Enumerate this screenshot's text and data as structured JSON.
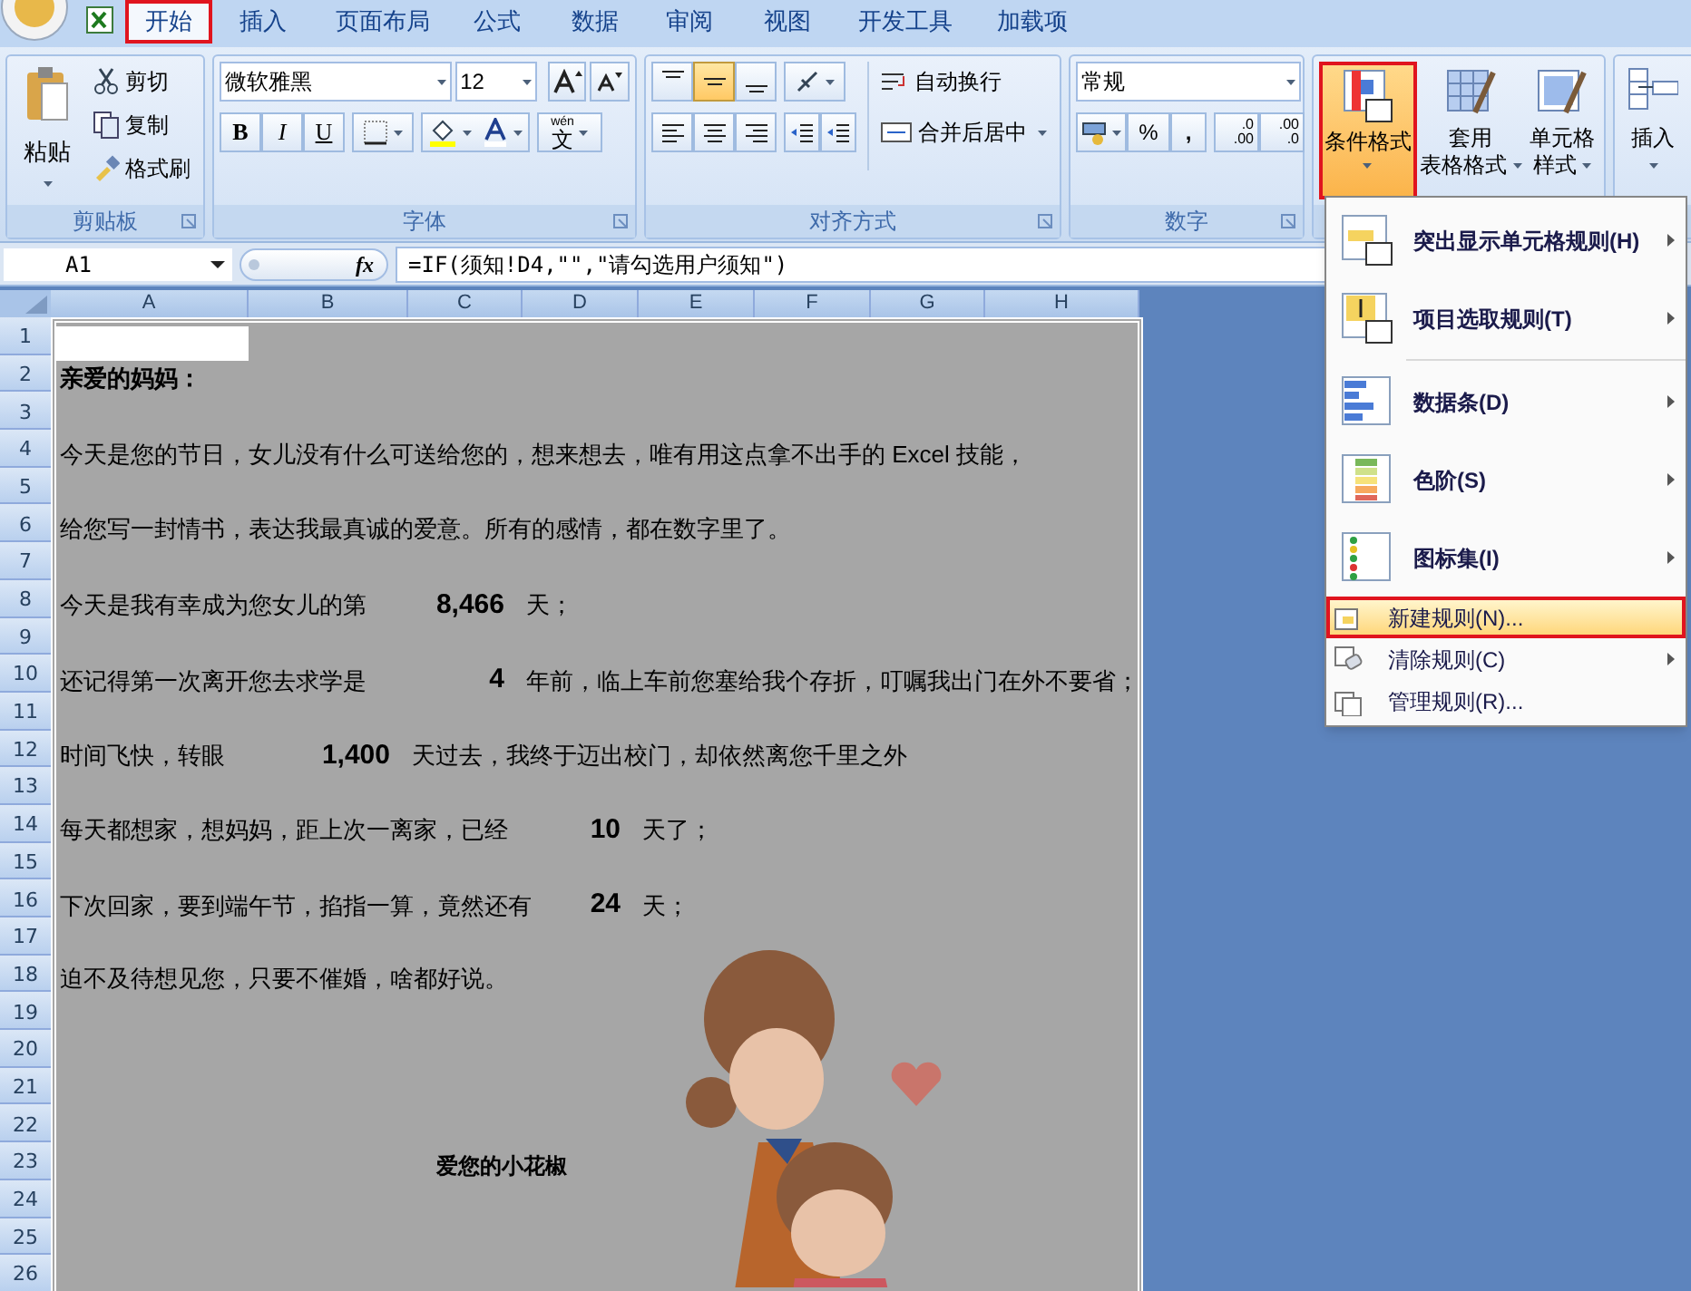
{
  "tabs": [
    {
      "label": "开始",
      "selected": true
    },
    {
      "label": "插入",
      "selected": false
    },
    {
      "label": "页面布局",
      "selected": false
    },
    {
      "label": "公式",
      "selected": false
    },
    {
      "label": "数据",
      "selected": false
    },
    {
      "label": "审阅",
      "selected": false
    },
    {
      "label": "视图",
      "selected": false
    },
    {
      "label": "开发工具",
      "selected": false
    },
    {
      "label": "加载项",
      "selected": false
    }
  ],
  "clipboard": {
    "title": "剪贴板",
    "paste": "粘贴",
    "cut": "剪切",
    "copy": "复制",
    "format_painter": "格式刷"
  },
  "font": {
    "title": "字体",
    "font_name": "微软雅黑",
    "font_size": "12",
    "bold": "B",
    "italic": "I",
    "underline": "U",
    "phonetic": "文",
    "phonetic_ruby": "wén"
  },
  "alignment": {
    "title": "对齐方式",
    "vertical": [
      {
        "selected": false
      },
      {
        "selected": true
      },
      {
        "selected": false
      }
    ],
    "wrap_text": "自动换行",
    "merge_center": "合并后居中"
  },
  "number": {
    "title": "数字",
    "format": "常规",
    "percent": "%",
    "comma": ",",
    "increase_decimal": [
      ".0",
      ".00"
    ],
    "decrease_decimal": [
      ".00",
      ".0"
    ]
  },
  "styles": {
    "conditional": {
      "label": "条件格式",
      "open": true
    },
    "table_format": [
      "套用",
      "表格格式"
    ],
    "cell_styles": [
      "单元格",
      "样式"
    ]
  },
  "cells_group": {
    "insert": "插入"
  },
  "formula_bar": {
    "name_box": "A1",
    "fx": "fx",
    "formula": "=IF(须知!D4,\"\",\"请勾选用户须知\")"
  },
  "sheet": {
    "columns": [
      "A",
      "B",
      "C",
      "D",
      "E",
      "F",
      "G",
      "H"
    ],
    "rows": [
      {
        "number": "1",
        "cells": [
          {
            "kind": "blank",
            "selected": true
          }
        ]
      },
      {
        "number": "2",
        "cells": [
          {
            "kind": "heading",
            "text": "亲爱的妈妈："
          }
        ]
      },
      {
        "number": "3",
        "cells": []
      },
      {
        "number": "4",
        "cells": [
          {
            "kind": "text",
            "text": "今天是您的节日，女儿没有什么可送给您的，想来想去，唯有用这点拿不出手的 Excel 技能，"
          }
        ]
      },
      {
        "number": "5",
        "cells": []
      },
      {
        "number": "6",
        "cells": [
          {
            "kind": "text",
            "text": "给您写一封情书，表达我最真诚的爱意。所有的感情，都在数字里了。"
          }
        ]
      },
      {
        "number": "7",
        "cells": []
      },
      {
        "number": "8",
        "cells": [
          {
            "kind": "text",
            "text": "今天是我有幸成为您女儿的第"
          },
          {
            "kind": "value",
            "text": "8,466"
          },
          {
            "kind": "text",
            "text": "天；"
          }
        ]
      },
      {
        "number": "9",
        "cells": []
      },
      {
        "number": "10",
        "cells": [
          {
            "kind": "text",
            "text": "还记得第一次离开您去求学是"
          },
          {
            "kind": "value",
            "text": "4"
          },
          {
            "kind": "text",
            "text": "年前，临上车前您塞给我个存折，叮嘱我出门在外不要省；"
          }
        ]
      },
      {
        "number": "11",
        "cells": []
      },
      {
        "number": "12",
        "cells": [
          {
            "kind": "text",
            "text": "时间飞快，转眼"
          },
          {
            "kind": "value",
            "text": "1,400"
          },
          {
            "kind": "text",
            "text": "天过去，我终于迈出校门，却依然离您千里之外"
          }
        ]
      },
      {
        "number": "13",
        "cells": []
      },
      {
        "number": "14",
        "cells": [
          {
            "kind": "text",
            "text": "每天都想家，想妈妈，距上次一离家，已经"
          },
          {
            "kind": "value",
            "text": "10"
          },
          {
            "kind": "text",
            "text": "天了；"
          }
        ]
      },
      {
        "number": "15",
        "cells": []
      },
      {
        "number": "16",
        "cells": [
          {
            "kind": "text",
            "text": "下次回家，要到端午节，掐指一算，竟然还有"
          },
          {
            "kind": "value",
            "text": "24"
          },
          {
            "kind": "text",
            "text": "天；"
          }
        ]
      },
      {
        "number": "17",
        "cells": []
      },
      {
        "number": "18",
        "cells": [
          {
            "kind": "text",
            "text": "迫不及待想见您，只要不催婚，啥都好说。"
          }
        ]
      },
      {
        "number": "19",
        "cells": []
      },
      {
        "number": "20",
        "cells": []
      },
      {
        "number": "21",
        "cells": []
      },
      {
        "number": "22",
        "cells": []
      },
      {
        "number": "23",
        "cells": [
          {
            "kind": "signature",
            "text": "爱您的小花椒"
          }
        ]
      },
      {
        "number": "24",
        "cells": []
      },
      {
        "number": "25",
        "cells": []
      },
      {
        "number": "26",
        "cells": []
      }
    ]
  },
  "menu": {
    "items": [
      {
        "kind": "large",
        "label": "突出显示单元格规则(H)",
        "submenu": true,
        "selected": false
      },
      {
        "kind": "large",
        "label": "项目选取规则(T)",
        "submenu": true,
        "selected": false
      },
      {
        "kind": "large",
        "label": "数据条(D)",
        "submenu": true,
        "selected": false
      },
      {
        "kind": "large",
        "label": "色阶(S)",
        "submenu": true,
        "selected": false
      },
      {
        "kind": "large",
        "label": "图标集(I)",
        "submenu": true,
        "selected": false
      },
      {
        "kind": "small",
        "label": "新建规则(N)...",
        "submenu": false,
        "selected": true
      },
      {
        "kind": "small",
        "label": "清除规则(C)",
        "submenu": true,
        "selected": false
      },
      {
        "kind": "small",
        "label": "管理规则(R)...",
        "submenu": false,
        "selected": false
      }
    ]
  }
}
